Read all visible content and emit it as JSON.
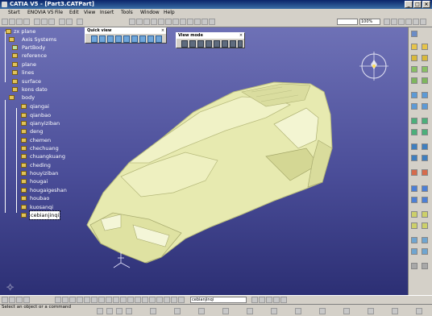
{
  "window": {
    "title": "CATIA V5 - [Part3.CATPart]",
    "buttons": [
      "_",
      "□",
      "×"
    ]
  },
  "menu": {
    "items": [
      "Start",
      "ENOVIA V5",
      "File",
      "Edit",
      "View",
      "Insert",
      "Tools",
      "Window",
      "Help"
    ]
  },
  "toolbar": {
    "layer_value": "",
    "zoom_value": "100%"
  },
  "quick_view": {
    "title": "Quick view"
  },
  "view_mode": {
    "title": "View mode"
  },
  "tree": {
    "items": [
      {
        "label": "zx plane"
      },
      {
        "label": "Axis Systems"
      },
      {
        "label": "PartBody"
      },
      {
        "label": "reference"
      },
      {
        "label": "plane"
      },
      {
        "label": "lines"
      },
      {
        "label": "surface"
      },
      {
        "label": "kons dato"
      },
      {
        "label": "body"
      },
      {
        "label": "qiangai"
      },
      {
        "label": "qianbao"
      },
      {
        "label": "qianyiziban"
      },
      {
        "label": "deng"
      },
      {
        "label": "chemen"
      },
      {
        "label": "chechuang"
      },
      {
        "label": "chuangkuang"
      },
      {
        "label": "cheding"
      },
      {
        "label": "houyiziban"
      },
      {
        "label": "hougai"
      },
      {
        "label": "hougaigeshan"
      },
      {
        "label": "houbao"
      },
      {
        "label": "kuosanqi"
      },
      {
        "label": "cebianjinqi"
      }
    ]
  },
  "bottom_toolbar": {
    "selector_value": "cebianjinqi"
  },
  "status": {
    "text": "Select an object or a command"
  },
  "colors": {
    "model_fill": "#e8ebb4",
    "viewport_top": "#6e71b6",
    "viewport_bottom": "#2c2f74"
  }
}
